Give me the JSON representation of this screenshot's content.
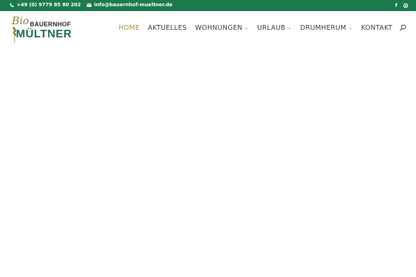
{
  "topbar": {
    "phone": "+49 (0) 9779 85 80 202",
    "email": "info@bauernhof-mueltner.de",
    "phone_icon": "phone-icon",
    "email_icon": "mail-icon",
    "facebook_icon": "facebook-icon",
    "instagram_icon": "instagram-icon",
    "facebook_glyph": "f"
  },
  "logo": {
    "bio": "Bio",
    "bauernhof": "BAUERNHOF",
    "name": "MÜLTNER"
  },
  "nav": {
    "items": [
      {
        "label": "HOME",
        "active": true,
        "dropdown": false
      },
      {
        "label": "AKTUELLES",
        "active": false,
        "dropdown": false
      },
      {
        "label": "WOHNUNGEN",
        "active": false,
        "dropdown": true
      },
      {
        "label": "URLAUB",
        "active": false,
        "dropdown": true
      },
      {
        "label": "DRUMHERUM",
        "active": false,
        "dropdown": true
      },
      {
        "label": "KONTAKT",
        "active": false,
        "dropdown": false
      }
    ],
    "caret": "⌄",
    "search_icon": "search-icon"
  },
  "colors": {
    "topbar_bg": "#1c7a4c",
    "accent_active": "#a88f3c",
    "logo_green": "#1c6b44"
  }
}
